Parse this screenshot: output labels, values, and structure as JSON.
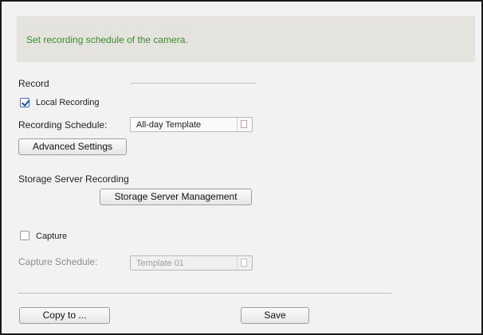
{
  "banner": {
    "text": "Set recording schedule of the camera."
  },
  "record": {
    "section_label": "Record",
    "local_recording": {
      "label": "Local Recording",
      "checked": true
    },
    "schedule_label": "Recording Schedule:",
    "schedule_value": "All-day Template",
    "advanced_button": "Advanced Settings"
  },
  "storage": {
    "section_label": "Storage Server Recording",
    "management_button": "Storage Server Management"
  },
  "capture": {
    "label": "Capture",
    "checked": false,
    "schedule_label": "Capture Schedule:",
    "schedule_value": "Template 01"
  },
  "footer": {
    "copy_button": "Copy to ...",
    "save_button": "Save"
  },
  "colors": {
    "banner_text": "#3d8a2e",
    "banner_bg": "#e4e3de",
    "panel_bg": "#f2f2f2"
  },
  "icons": {
    "select_button": "page-icon"
  }
}
